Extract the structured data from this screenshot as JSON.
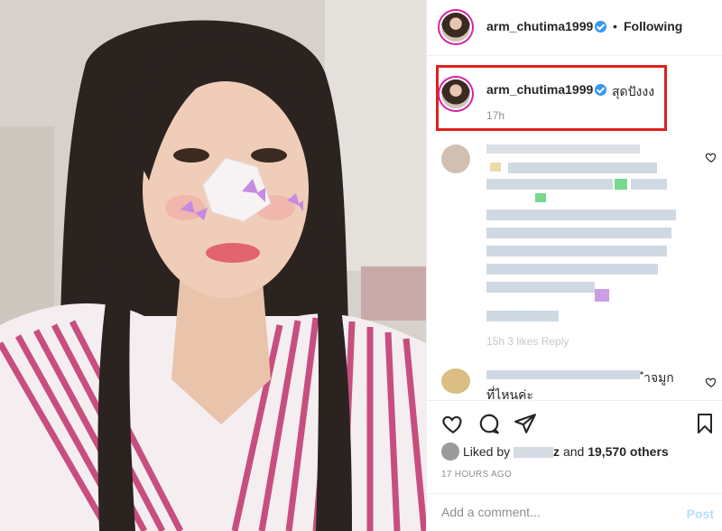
{
  "header": {
    "username": "arm_chutima1999",
    "separator": "•",
    "follow_label": "Following"
  },
  "caption": {
    "username": "arm_chutima1999",
    "text": "สุดปังงง",
    "time": "17h"
  },
  "comments": {
    "first_meta": "15h  3 likes  Reply",
    "second_text_tail": "ำจมูก",
    "second_text_line2": "ที่ไหนค่ะ"
  },
  "likes": {
    "prefix": "Liked by",
    "partial_name": "z",
    "conjunction": "and",
    "count": "19,570 others"
  },
  "timestamp": "17 HOURS AGO",
  "comment_box": {
    "placeholder": "Add a comment...",
    "post_label": "Post"
  },
  "colors": {
    "verified": "#3897f0",
    "highlight_box": "#e0201a",
    "post_disabled": "#b2dffc"
  },
  "icons": [
    "verified-icon",
    "heart-icon",
    "comment-icon",
    "share-icon",
    "bookmark-icon",
    "comment-like-icon"
  ]
}
